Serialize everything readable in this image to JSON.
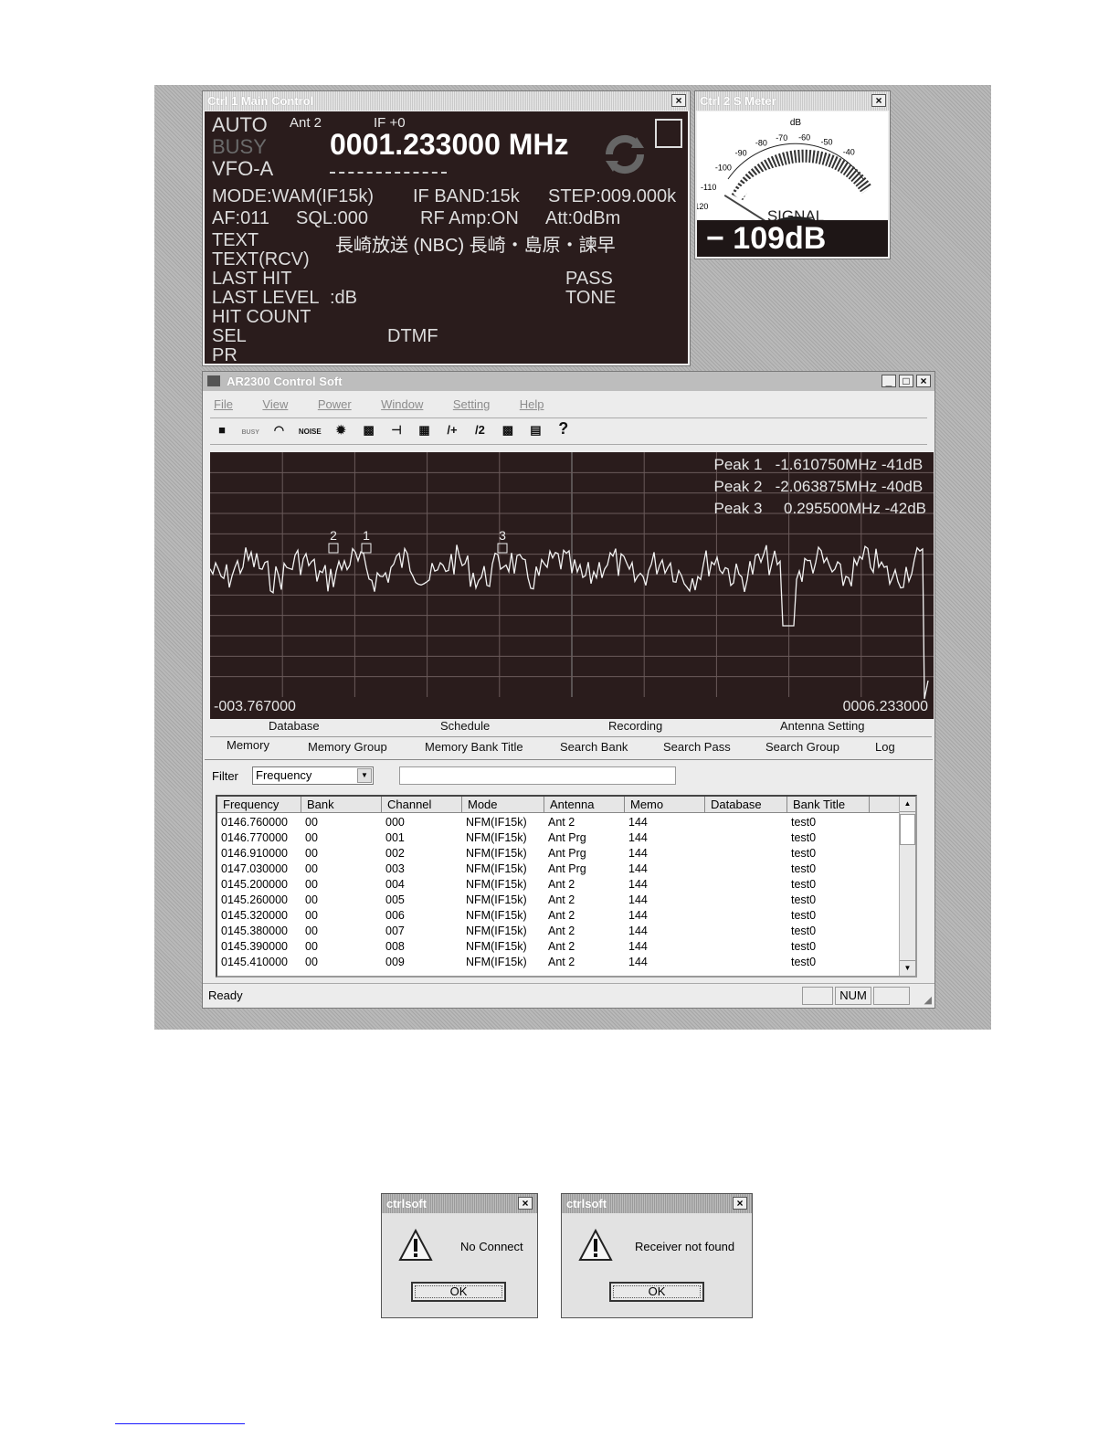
{
  "main_control": {
    "title": "Ctrl 1   Main Control",
    "close": "×",
    "auto": "AUTO",
    "busy": "BUSY",
    "vfo": "VFO-A",
    "antenna": "Ant 2",
    "if_offset": "IF +0",
    "frequency": "0001.233000 MHz",
    "mode_line": "MODE:WAM(IF15k)",
    "if_band": "IF BAND:15k",
    "step": "STEP:009.000k",
    "af": "AF:011",
    "sql": "SQL:000",
    "rf_amp": "RF Amp:ON",
    "att": "Att:0dBm",
    "text_label": "TEXT",
    "text_value": "長崎放送 (NBC) 長崎・島原・諫早",
    "text_rcv": "TEXT(RCV)",
    "last_hit": "LAST HIT",
    "last_level": "LAST LEVEL",
    "last_level_value": ":dB",
    "hit_count": "HIT COUNT",
    "sel": "SEL",
    "pr": "PR",
    "pass": "PASS",
    "tone": "TONE",
    "dtmf": "DTMF"
  },
  "s_meter": {
    "title": "Ctrl 2   S Meter",
    "close": "×",
    "db_label": "dB",
    "scale": [
      "-120",
      "-110",
      "-100",
      "-90",
      "-80",
      "-70",
      "-60",
      "-50",
      "-40"
    ],
    "signal_label": "SIGNAL",
    "readout": "− 109dB",
    "level_db": -109
  },
  "app": {
    "title": "AR2300 Control Soft",
    "controls": [
      "_",
      "□",
      "×"
    ],
    "menu": [
      "File",
      "View",
      "Power",
      "Window",
      "Setting",
      "Help"
    ],
    "toolbar": [
      "save-icon",
      "busy-icon",
      "meter-icon",
      "noise-icon",
      "bug-icon",
      "card-icon",
      "antenna-icon",
      "grid-icon",
      "plus-icon",
      "half-icon",
      "list-icon",
      "list2-icon",
      "help-icon"
    ],
    "toolbar_text": {
      "busy": "BUSY",
      "noise": "NOISE",
      "plus": "/+",
      "half": "/2",
      "help": "?"
    },
    "peaks": [
      {
        "label": "Peak 1",
        "freq": "-1.610750MHz",
        "level": "-41dB"
      },
      {
        "label": "Peak 2",
        "freq": "-2.063875MHz",
        "level": "-40dB"
      },
      {
        "label": "Peak 3",
        "freq": "0.295500MHz",
        "level": "-42dB"
      }
    ],
    "spectrum_start": "-003.767000",
    "spectrum_end": "0006.233000",
    "marker_labels": [
      "2",
      "1",
      "3"
    ],
    "tabs_row1": [
      "Database",
      "Schedule",
      "Recording",
      "Antenna Setting"
    ],
    "tabs_row2": [
      "Memory",
      "Memory Group",
      "Memory Bank Title",
      "Search Bank",
      "Search Pass",
      "Search Group",
      "Log"
    ],
    "filter_label": "Filter",
    "filter_value": "Frequency",
    "filter_text": "",
    "columns": [
      "Frequency",
      "Bank",
      "Channel",
      "Mode",
      "Antenna",
      "Memo",
      "Database",
      "Bank Title"
    ],
    "rows": [
      [
        "0146.760000",
        "00",
        "000",
        "NFM(IF15k)",
        "Ant 2",
        "144",
        "",
        "test0"
      ],
      [
        "0146.770000",
        "00",
        "001",
        "NFM(IF15k)",
        "Ant Prg",
        "144",
        "",
        "test0"
      ],
      [
        "0146.910000",
        "00",
        "002",
        "NFM(IF15k)",
        "Ant Prg",
        "144",
        "",
        "test0"
      ],
      [
        "0147.030000",
        "00",
        "003",
        "NFM(IF15k)",
        "Ant Prg",
        "144",
        "",
        "test0"
      ],
      [
        "0145.200000",
        "00",
        "004",
        "NFM(IF15k)",
        "Ant 2",
        "144",
        "",
        "test0"
      ],
      [
        "0145.260000",
        "00",
        "005",
        "NFM(IF15k)",
        "Ant 2",
        "144",
        "",
        "test0"
      ],
      [
        "0145.320000",
        "00",
        "006",
        "NFM(IF15k)",
        "Ant 2",
        "144",
        "",
        "test0"
      ],
      [
        "0145.380000",
        "00",
        "007",
        "NFM(IF15k)",
        "Ant 2",
        "144",
        "",
        "test0"
      ],
      [
        "0145.390000",
        "00",
        "008",
        "NFM(IF15k)",
        "Ant 2",
        "144",
        "",
        "test0"
      ],
      [
        "0145.410000",
        "00",
        "009",
        "NFM(IF15k)",
        "Ant 2",
        "144",
        "",
        "test0"
      ]
    ],
    "status": "Ready",
    "status_num": "NUM"
  },
  "dialogs": [
    {
      "title": "ctrlsoft",
      "close": "×",
      "message": "No Connect",
      "ok": "OK"
    },
    {
      "title": "ctrlsoft",
      "close": "×",
      "message": "Receiver not found",
      "ok": "OK"
    }
  ]
}
